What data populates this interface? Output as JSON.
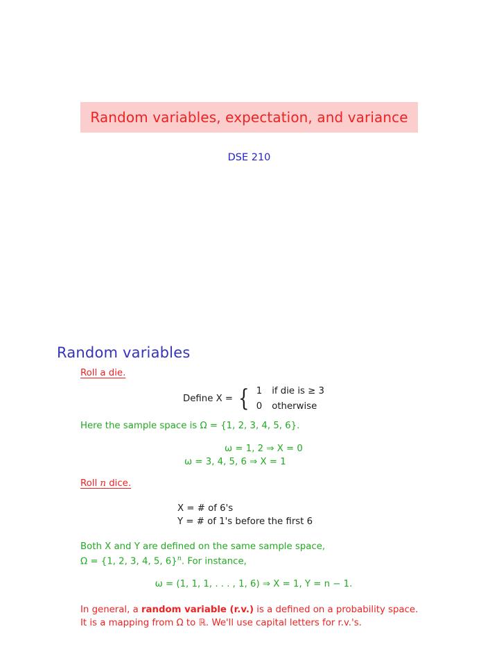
{
  "slide": {
    "title": "Random variables, expectation, and variance",
    "subtitle": "DSE 210",
    "banner_bg_color": "#fccdcd",
    "title_color": "#ee2222",
    "subtitle_color": "#2222cc",
    "section_heading": "Random variables",
    "section_heading_color": "#3333bb",
    "body_red_color": "#ee2222",
    "body_green_color": "#22aa22",
    "body_black_color": "#1a1a1a"
  },
  "content": {
    "item1_label": "Roll a die.",
    "define_lhs": "Define X =",
    "cases": [
      {
        "value": "1",
        "condition": "if die is ≥ 3"
      },
      {
        "value": "0",
        "condition": "otherwise"
      }
    ],
    "sample_space_line": "Here the sample space is Ω = {1, 2, 3, 4, 5, 6}.",
    "implication_1": "ω = 1, 2 ⇒ X = 0",
    "implication_2": "ω = 3, 4, 5, 6 ⇒ X = 1",
    "item2_label_pre": "Roll ",
    "item2_label_var": "n",
    "item2_label_post": " dice.",
    "def_X": "X = # of 6's",
    "def_Y": "Y = # of 1's before the first 6",
    "both_line_1": "Both X and Y are defined on the same sample space,",
    "both_line_2_pre": "Ω = {1, 2, 3, 4, 5, 6}",
    "both_line_2_sup": "n",
    "both_line_2_post": ". For instance,",
    "instance_eq": "ω = (1, 1, 1, . . . , 1, 6)  ⇒  X = 1, Y = n − 1.",
    "general_line_1_pre": "In general, a ",
    "general_line_1_bold": "random variable (r.v.)",
    "general_line_1_post": " is a defined on a probability space.",
    "general_line_2": "It is a mapping from Ω to ℝ. We'll use capital letters for r.v.'s."
  }
}
